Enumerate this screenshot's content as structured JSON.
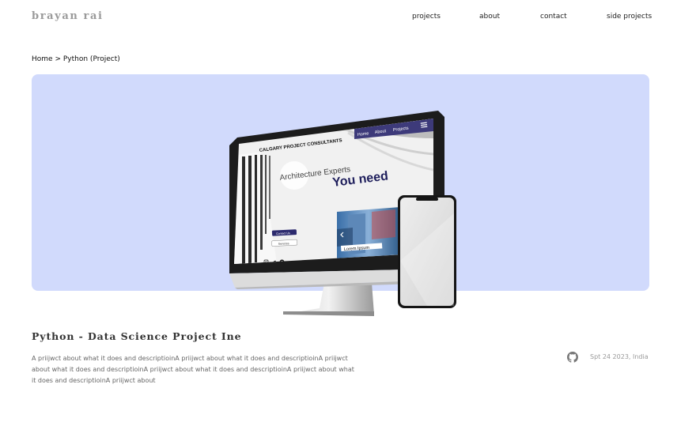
{
  "header": {
    "logo": "brayan rai",
    "nav": [
      "projects",
      "about",
      "contact",
      "side projects"
    ]
  },
  "breadcrumb": {
    "home": "Home",
    "separator": ">",
    "current": "Python (Project)"
  },
  "mockup": {
    "site_title": "CALGARY PROJECT CONSULTANTS",
    "site_nav": [
      "Home",
      "About",
      "Projects"
    ],
    "headline_small": "Architecture Experts",
    "headline_big": "You need",
    "button_contact": "Contact Us",
    "button_services": "Services",
    "card_label": "Lorem Ipsum"
  },
  "project": {
    "title": "Python - Data Science Project Ine",
    "description": "A priijwct about what it does and descriptioinA priijwct about what it does and descriptioinA priijwct about what it does and descriptioinA priijwct about what it does and descriptioinA priijwct about what it does and descriptioinA priijwct about",
    "date": "Spt 24 2023, India"
  },
  "colors": {
    "hero_bg": "#d1dafc",
    "site_nav_bg": "#3d3a7a",
    "accent": "#1f1f5c"
  },
  "icons": [
    "github-icon",
    "instagram-icon",
    "twitter-icon",
    "facebook-icon",
    "hamburger-icon",
    "chevron-left-icon"
  ]
}
